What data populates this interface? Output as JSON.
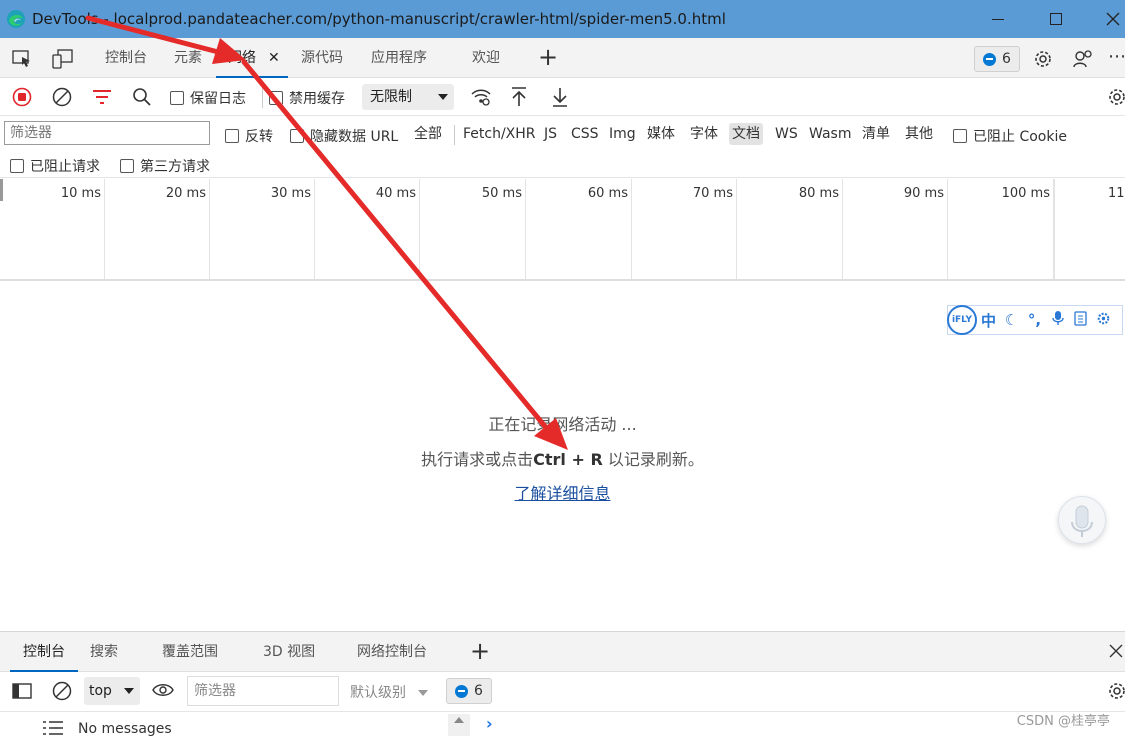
{
  "window": {
    "title": "DevTools - localprod.pandateacher.com/python-manuscript/crawler-html/spider-men5.0.html"
  },
  "main_tabs": [
    {
      "label": "控制台"
    },
    {
      "label": "元素"
    },
    {
      "label": "网络"
    },
    {
      "label": "源代码"
    },
    {
      "label": "应用程序"
    },
    {
      "label": "欢迎"
    }
  ],
  "issues_count": "6",
  "toolbar": {
    "preserve_log": "保留日志",
    "disable_cache": "禁用缓存",
    "throttling": "无限制"
  },
  "filter": {
    "placeholder": "筛选器",
    "invert": "反转",
    "hide_data_url": "隐藏数据 URL",
    "types": [
      "全部",
      "Fetch/XHR",
      "JS",
      "CSS",
      "Img",
      "媒体",
      "字体",
      "文档",
      "WS",
      "Wasm",
      "清单",
      "其他"
    ],
    "active_type": "文档",
    "blocked_cookies": "已阻止 Cookie",
    "blocked_requests": "已阻止请求",
    "third_party": "第三方请求"
  },
  "timeline": {
    "ticks": [
      "10 ms",
      "20 ms",
      "30 ms",
      "40 ms",
      "50 ms",
      "60 ms",
      "70 ms",
      "80 ms",
      "90 ms",
      "100 ms",
      "11"
    ]
  },
  "content": {
    "recording": "正在记录网络活动 ...",
    "hint_pre": "执行请求或点击",
    "hint_keys": "Ctrl + R",
    "hint_post": " 以记录刷新。",
    "learn_more": "了解详细信息"
  },
  "ifly": {
    "logo": "iFLY",
    "lang": "中"
  },
  "drawer": {
    "tabs": [
      {
        "label": "控制台"
      },
      {
        "label": "搜索"
      },
      {
        "label": "覆盖范围"
      },
      {
        "label": "3D 视图"
      },
      {
        "label": "网络控制台"
      }
    ],
    "context": "top",
    "filter_placeholder": "筛选器",
    "levels": "默认级别",
    "issues_count": "6",
    "no_messages": "No messages"
  },
  "watermark": "CSDN @桂亭亭",
  "colors": {
    "titlebar": "#5b9bd5",
    "accent": "#0067c0",
    "record_red": "#e0262b",
    "arrow_red": "#e52a2a"
  }
}
